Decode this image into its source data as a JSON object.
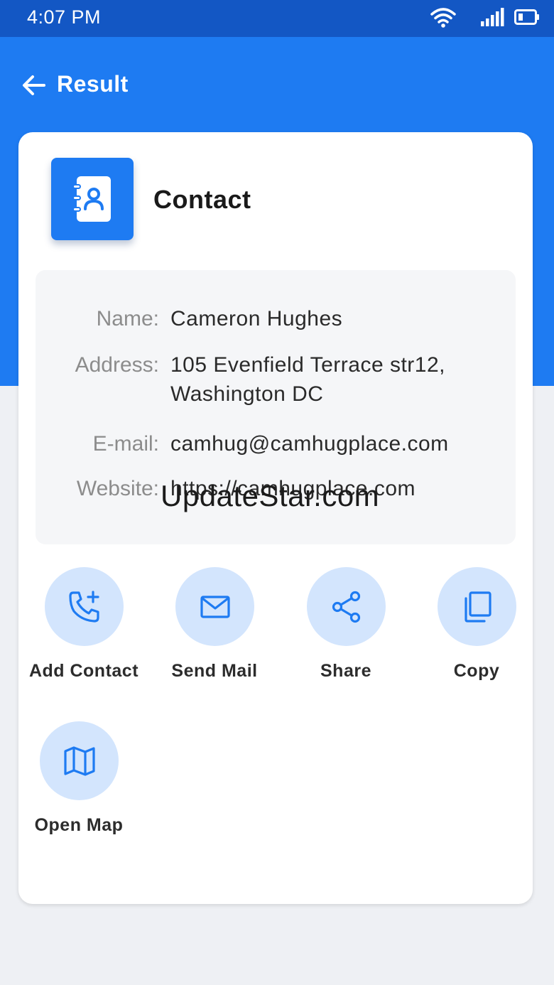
{
  "status_bar": {
    "time": "4:07 PM"
  },
  "appbar": {
    "title": "Result",
    "back_icon": "arrow-left-icon"
  },
  "card": {
    "type_title": "Contact",
    "type_icon": "contact-book-icon",
    "fields": [
      {
        "label": "Name:",
        "value": "Cameron Hughes"
      },
      {
        "label": "Address:",
        "value": "105 Evenfield Terrace str12, Washington DC"
      },
      {
        "label": "E-mail:",
        "value": "camhug@camhugplace.com"
      },
      {
        "label": "Website:",
        "value": "https://camhugplace.com"
      }
    ],
    "watermark": "UpdateStar.com"
  },
  "actions": [
    {
      "label": "Add Contact",
      "icon": "phone-plus-icon"
    },
    {
      "label": "Send Mail",
      "icon": "mail-icon"
    },
    {
      "label": "Share",
      "icon": "share-icon"
    },
    {
      "label": "Copy",
      "icon": "copy-icon"
    },
    {
      "label": "Open Map",
      "icon": "map-icon"
    }
  ],
  "colors": {
    "primary": "#1e7bf2",
    "status_bar": "#1357c4",
    "action_circle": "#d3e5fd",
    "background": "#eef0f4"
  }
}
